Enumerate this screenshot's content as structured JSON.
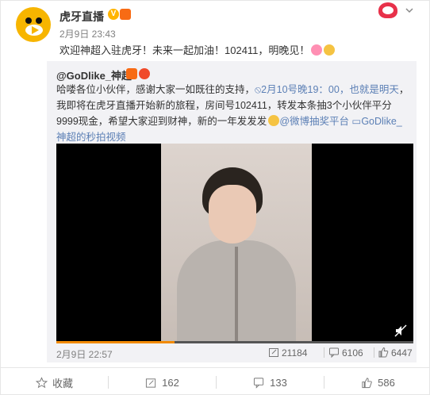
{
  "post": {
    "author": "虎牙直播",
    "time": "2月9日 23:43",
    "text": "欢迎神超入驻虎牙！未来一起加油！102411，明晚见！"
  },
  "repost": {
    "author": "@GoDlike_神超",
    "text_plain_1": "哈喽各位小伙伴，感谢大家一如既往的支持，",
    "link_1": "2月10号晚19：00，也就是明天",
    "text_plain_2": "，我即将在虎牙直播开始新的旅程，房间号102411，转发本条抽3个小伙伴平分9999现金，希望大家迎到财神，新的一年发发发",
    "link_2": "@微博抽奖平台",
    "link_3": "GoDlike_神超的秒拍视频",
    "time": "2月9日 22:57",
    "reposts": "21184",
    "comments": "6106",
    "likes": "6447",
    "video_progress": 0.33
  },
  "footer": {
    "favorite": "收藏",
    "repost": "162",
    "comment": "133",
    "like": "586"
  },
  "colors": {
    "link": "#5b7fb5",
    "brand_yellow": "#f7b500",
    "progress": "#f28a00"
  }
}
